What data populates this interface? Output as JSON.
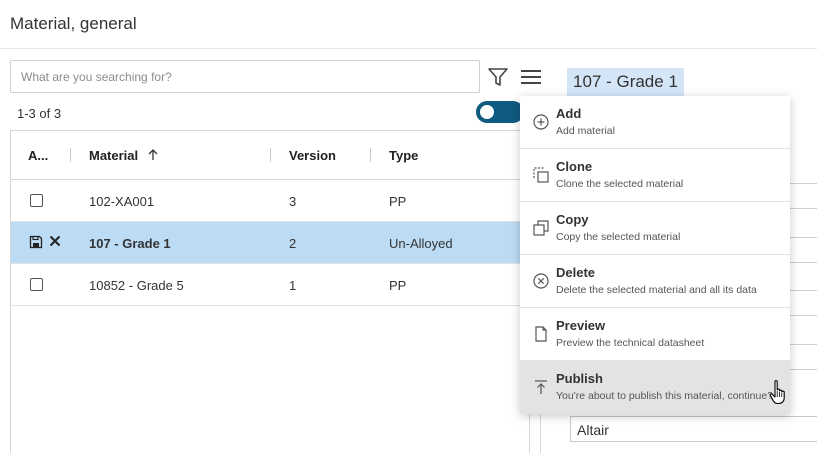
{
  "page": {
    "title": "Material, general"
  },
  "search": {
    "placeholder": "What are you searching for?"
  },
  "toolbar": {
    "filter_icon": "filter-icon",
    "menu_icon": "hamburger-menu-icon"
  },
  "results": {
    "count_text": "1-3 of 3"
  },
  "detail": {
    "header": "107 - Grade 1",
    "field_value": "Altair"
  },
  "grid": {
    "columns": [
      {
        "label": "A..."
      },
      {
        "label": "Material",
        "sort": "ascending"
      },
      {
        "label": "Version"
      },
      {
        "label": "Type"
      }
    ],
    "rows": [
      {
        "material": "102-XA001",
        "version": "3",
        "type": "PP",
        "selected": false
      },
      {
        "material": "107 - Grade 1",
        "version": "2",
        "type": "Un-Alloyed",
        "selected": true
      },
      {
        "material": "10852 - Grade 5",
        "version": "1",
        "type": "PP",
        "selected": false
      }
    ]
  },
  "menu": {
    "items": [
      {
        "label": "Add",
        "description": "Add material",
        "icon": "plus-circle-icon"
      },
      {
        "label": "Clone",
        "description": "Clone the selected material",
        "icon": "clone-icon"
      },
      {
        "label": "Copy",
        "description": "Copy the selected material",
        "icon": "copy-icon"
      },
      {
        "label": "Delete",
        "description": "Delete the selected material and all its data",
        "icon": "x-circle-icon"
      },
      {
        "label": "Preview",
        "description": "Preview the technical datasheet",
        "icon": "document-icon"
      },
      {
        "label": "Publish",
        "description": "You're about to publish this material, continue?",
        "icon": "publish-icon"
      }
    ]
  },
  "colors": {
    "selected_row": "#bcdbf4",
    "header_highlight": "#d3e5f7",
    "toggle": "#0e5a80",
    "menu_hover": "#e3e3e3"
  }
}
